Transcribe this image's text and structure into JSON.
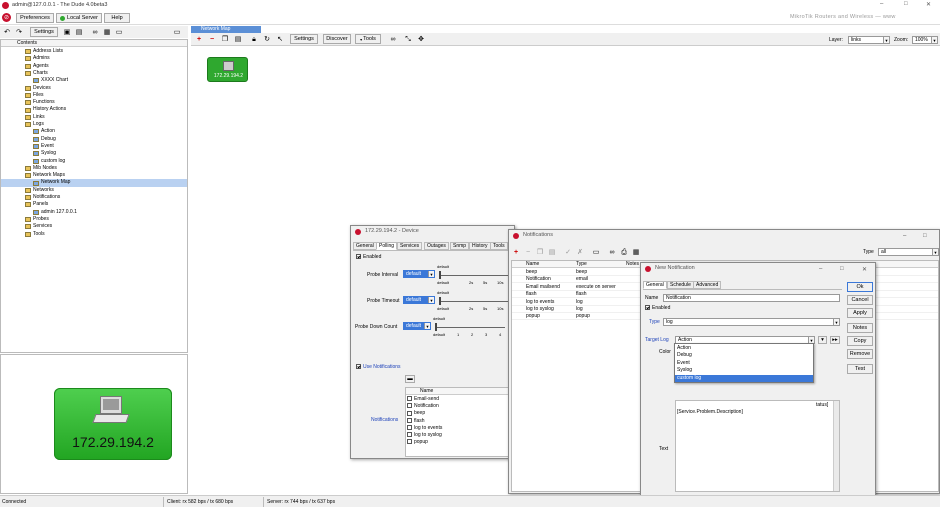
{
  "app": {
    "title": "admin@127.0.0.1 - The Dude 4.0beta3",
    "brand": "MikroTik Routers and Wireless — www",
    "menu": {
      "preferences": "Preferences",
      "local_server": "Local Server",
      "help": "Help"
    },
    "toolbar": {
      "settings": "Settings"
    },
    "window_controls": {
      "min": "–",
      "max": "□",
      "close": "✕"
    }
  },
  "tree": {
    "header": "Contents",
    "items": [
      {
        "label": "Address Lists",
        "level": 1
      },
      {
        "label": "Admins",
        "level": 1
      },
      {
        "label": "Agents",
        "level": 1
      },
      {
        "label": "Charts",
        "level": 1
      },
      {
        "label": "XXXX Chart",
        "level": 2
      },
      {
        "label": "Devices",
        "level": 1
      },
      {
        "label": "Files",
        "level": 1
      },
      {
        "label": "Functions",
        "level": 1
      },
      {
        "label": "History Actions",
        "level": 1
      },
      {
        "label": "Links",
        "level": 1
      },
      {
        "label": "Logs",
        "level": 1
      },
      {
        "label": "Action",
        "level": 2
      },
      {
        "label": "Debug",
        "level": 2
      },
      {
        "label": "Event",
        "level": 2
      },
      {
        "label": "Syslog",
        "level": 2
      },
      {
        "label": "custom log",
        "level": 2
      },
      {
        "label": "Mib Nodes",
        "level": 1
      },
      {
        "label": "Network Maps",
        "level": 1
      },
      {
        "label": "Network Map",
        "level": 2,
        "selected": true
      },
      {
        "label": "Networks",
        "level": 1
      },
      {
        "label": "Notifications",
        "level": 1
      },
      {
        "label": "Panels",
        "level": 1
      },
      {
        "label": "admin 127.0.0.1",
        "level": 2
      },
      {
        "label": "Probes",
        "level": 1
      },
      {
        "label": "Services",
        "level": 1
      },
      {
        "label": "Tools",
        "level": 1
      }
    ]
  },
  "preview": {
    "ip": "172.29.194.2"
  },
  "map": {
    "tab": "Network Map",
    "buttons": {
      "settings": "Settings",
      "discover": "Discover",
      "tools": "Tools"
    },
    "layer_label": "Layer:",
    "layer_value": "links",
    "zoom_label": "Zoom:",
    "zoom_value": "100%",
    "device_ip": "172.29.194.2"
  },
  "device_win": {
    "title": "172.29.194.2 - Device",
    "tabs": [
      "General",
      "Polling",
      "Services",
      "Outages",
      "Snmp",
      "History",
      "Tools"
    ],
    "active_tab": "Polling",
    "enabled_label": "Enabled",
    "probe_interval_label": "Probe Interval",
    "probe_timeout_label": "Probe Timeout",
    "probe_down_label": "Probe Down Count",
    "default_value": "default",
    "slider_default": "default",
    "interval_ticks": [
      "default",
      "2s",
      "5s",
      "10s"
    ],
    "timeout_ticks": [
      "default",
      "2s",
      "5s",
      "10s"
    ],
    "down_ticks": [
      "default",
      "1",
      "2",
      "3",
      "4"
    ],
    "use_notifications_label": "Use Notifications",
    "notifications_label": "Notifications",
    "list_header": "Name",
    "list_items": [
      "Email-send",
      "Notification",
      "beep",
      "flash",
      "log to events",
      "log to syslog",
      "popup"
    ]
  },
  "notif_win": {
    "title": "Notifications",
    "type_label": "Type",
    "type_value": "all",
    "columns": [
      "Name",
      "Type",
      "Notes"
    ],
    "rows": [
      [
        "beep",
        "beep"
      ],
      [
        "Notification",
        "email"
      ],
      [
        "Email mailsend",
        "execute on server"
      ],
      [
        "flash",
        "flash"
      ],
      [
        "log to events",
        "log"
      ],
      [
        "log to syslog",
        "log"
      ],
      [
        "popup",
        "popup"
      ]
    ]
  },
  "new_notif": {
    "title": "New Notification",
    "tabs": [
      "General",
      "Schedule",
      "Advanced"
    ],
    "name_label": "Name",
    "name_value": "Notification",
    "enabled_label": "Enabled",
    "type_label": "Type",
    "type_value": "log",
    "target_log_label": "Target Log",
    "target_log_value": "Action",
    "color_label": "Color",
    "text_label": "Text",
    "dropdown_options": [
      "Action",
      "Debug",
      "Event",
      "Syslog",
      "custom log"
    ],
    "dropdown_selected": "custom log",
    "text_line1_suffix": "tatus]",
    "text_line2": "[Service.Problem.Description]",
    "buttons": {
      "ok": "Ok",
      "cancel": "Cancel",
      "apply": "Apply",
      "notes": "Notes",
      "copy": "Copy",
      "remove": "Remove",
      "test": "Test"
    }
  },
  "status": {
    "left": "Connected",
    "client": "Client: rx 582 bps / tx 680 bps",
    "server": "Server: rx 744 bps / tx 637 bps"
  },
  "colors": {
    "selected": "#3b78d8",
    "device_green": "#2fa82f",
    "dude_red": "#c8102e"
  }
}
